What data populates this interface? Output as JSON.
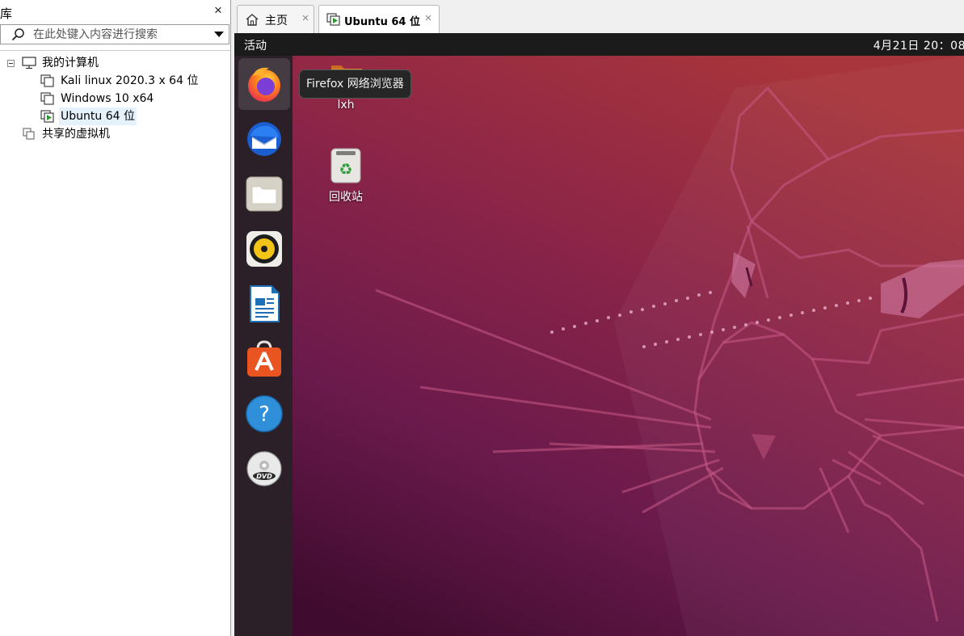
{
  "library": {
    "title": "库",
    "close_glyph": "×",
    "search": {
      "placeholder": "在此处键入内容进行搜索"
    },
    "tree": {
      "my_computer": "我的计算机",
      "vms": [
        "Kali linux 2020.3 x 64 位",
        "Windows 10 x64",
        "Ubuntu 64 位"
      ],
      "shared": "共享的虚拟机",
      "selected_index": 2
    }
  },
  "tabs": [
    {
      "label": "主页",
      "icon": "home-icon",
      "close": "×",
      "active": false
    },
    {
      "label": "Ubuntu 64 位",
      "icon": "vm-running-icon",
      "close": "×",
      "active": true
    }
  ],
  "ubuntu": {
    "topbar": {
      "activities": "活动",
      "clock": "4月21日 20：08"
    },
    "dock": [
      "firefox-icon",
      "thunderbird-icon",
      "files-icon",
      "rhythmbox-icon",
      "libreoffice-writer-icon",
      "ubuntu-software-icon",
      "help-icon",
      "dvd-icon"
    ],
    "tooltip": "Firefox 网络浏览器",
    "desktop": {
      "home_folder": "lxh",
      "trash": "回收站"
    }
  },
  "colors": {
    "wallpaper_top": "#a8353b",
    "wallpaper_mid": "#7c1f53",
    "wallpaper_bottom": "#3f0b2e",
    "dock": "#2c2028",
    "topbar": "#1b1b1b"
  }
}
